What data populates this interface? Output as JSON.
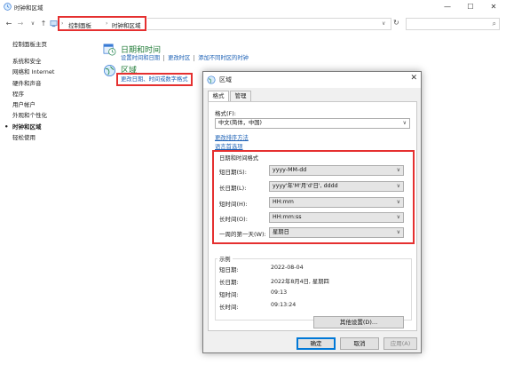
{
  "window": {
    "title": "时钟和区域",
    "controls": {
      "minimize": "—",
      "maximize": "☐",
      "close": "✕"
    }
  },
  "nav": {
    "back": "←",
    "forward": "→",
    "up": "↑",
    "dropdown": "∨",
    "refresh": "↻",
    "search_icon": "⌕"
  },
  "breadcrumb": {
    "sep1": "›",
    "item1": "控制面板",
    "sep2": "›",
    "item2": "时钟和区域",
    "sep3": "›"
  },
  "sidebar": {
    "home": "控制面板主页",
    "items": [
      "系统和安全",
      "网络和 Internet",
      "硬件和声音",
      "程序",
      "用户帐户",
      "外观和个性化",
      "时钟和区域",
      "轻松使用"
    ],
    "current_index": 6,
    "bullet": "•"
  },
  "content": {
    "datetime_title": "日期和时间",
    "datetime_links": [
      "设置时间和日期",
      "更改时区",
      "添加不同时区的时钟"
    ],
    "region_title": "区域",
    "region_link": "更改日期、时间或数字格式"
  },
  "dialog": {
    "title": "区域",
    "close": "✕",
    "tabs": [
      "格式",
      "管理"
    ],
    "format_label": "格式(F):",
    "format_value": "中文(简体，中国)",
    "link_sort": "更改排序方法",
    "link_lang": "语言首选项",
    "dt_group": "日期和时间格式",
    "rows": [
      {
        "label": "短日期(S):",
        "value": "yyyy-MM-dd"
      },
      {
        "label": "长日期(L):",
        "value": "yyyy'年'M'月'd'日', dddd"
      },
      {
        "label": "短时间(H):",
        "value": "HH:mm"
      },
      {
        "label": "长时间(O):",
        "value": "HH:mm:ss"
      },
      {
        "label": "一周的第一天(W):",
        "value": "星期日"
      }
    ],
    "example_group": "示例",
    "examples": [
      {
        "label": "短日期:",
        "value": "2022-08-04"
      },
      {
        "label": "长日期:",
        "value": "2022年8月4日, 星期四"
      },
      {
        "label": "短时间:",
        "value": "09:13"
      },
      {
        "label": "长时间:",
        "value": "09:13:24"
      }
    ],
    "other_settings": "其他设置(D)...",
    "ok": "确定",
    "cancel": "取消",
    "apply": "应用(A)"
  },
  "colors": {
    "highlight_red": "#e53030",
    "link_blue": "#1a5fb4",
    "title_green": "#1e7a35"
  }
}
